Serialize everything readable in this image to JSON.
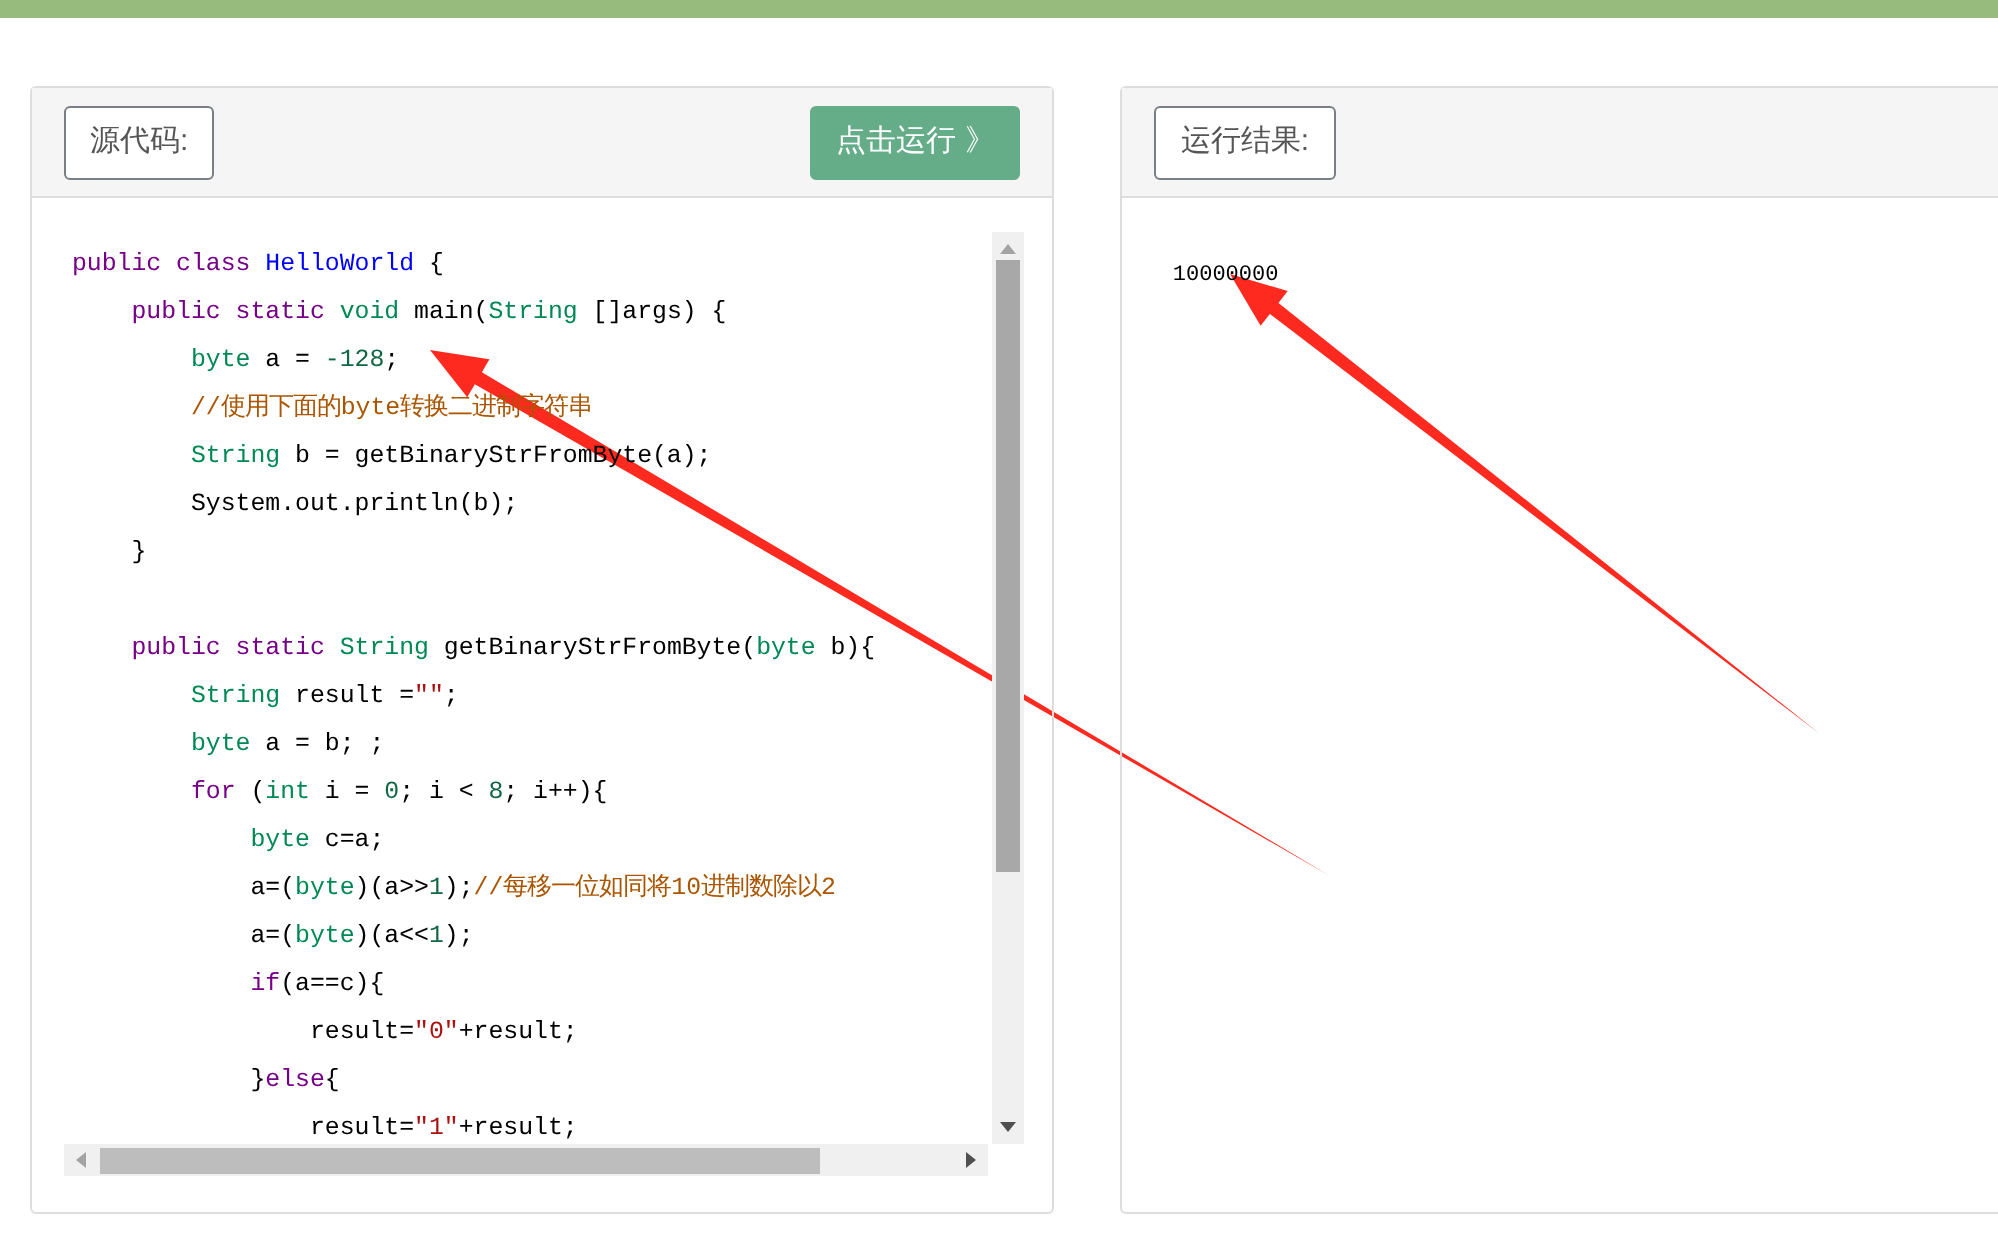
{
  "source_panel": {
    "label": "源代码:",
    "run_button": "点击运行 》",
    "code_lines": [
      {
        "kind": "code",
        "tokens": [
          {
            "kind": "keyword",
            "text": "public class "
          },
          {
            "kind": "classname",
            "text": "HelloWorld"
          },
          {
            "kind": "plain",
            "text": " {"
          }
        ]
      },
      {
        "kind": "code",
        "tokens": [
          {
            "kind": "keyword",
            "text": "    public static "
          },
          {
            "kind": "type",
            "text": "void"
          },
          {
            "kind": "plain",
            "text": " main("
          },
          {
            "kind": "type",
            "text": "String"
          },
          {
            "kind": "plain",
            "text": " []args) {"
          }
        ]
      },
      {
        "kind": "code",
        "tokens": [
          {
            "kind": "type",
            "text": "        byte"
          },
          {
            "kind": "plain",
            "text": " a = "
          },
          {
            "kind": "number",
            "text": "-128"
          },
          {
            "kind": "plain",
            "text": ";"
          }
        ]
      },
      {
        "kind": "code",
        "tokens": [
          {
            "kind": "comment",
            "text": "        //使用下面的byte转换二进制字符串"
          }
        ]
      },
      {
        "kind": "code",
        "tokens": [
          {
            "kind": "type",
            "text": "        String"
          },
          {
            "kind": "plain",
            "text": " b = getBinaryStrFromByte(a);"
          }
        ]
      },
      {
        "kind": "code",
        "tokens": [
          {
            "kind": "plain",
            "text": "        System.out.println(b);"
          }
        ]
      },
      {
        "kind": "code",
        "tokens": [
          {
            "kind": "plain",
            "text": "    }"
          }
        ]
      },
      {
        "kind": "blank"
      },
      {
        "kind": "code",
        "tokens": [
          {
            "kind": "keyword",
            "text": "    public static "
          },
          {
            "kind": "type",
            "text": "String"
          },
          {
            "kind": "plain",
            "text": " getBinaryStrFromByte("
          },
          {
            "kind": "type",
            "text": "byte"
          },
          {
            "kind": "plain",
            "text": " b){"
          }
        ]
      },
      {
        "kind": "code",
        "tokens": [
          {
            "kind": "type",
            "text": "        String"
          },
          {
            "kind": "plain",
            "text": " result ="
          },
          {
            "kind": "string",
            "text": "\"\""
          },
          {
            "kind": "plain",
            "text": ";"
          }
        ]
      },
      {
        "kind": "code",
        "tokens": [
          {
            "kind": "type",
            "text": "        byte"
          },
          {
            "kind": "plain",
            "text": " a = b; ;"
          }
        ]
      },
      {
        "kind": "code",
        "tokens": [
          {
            "kind": "keyword",
            "text": "        for"
          },
          {
            "kind": "plain",
            "text": " ("
          },
          {
            "kind": "type",
            "text": "int"
          },
          {
            "kind": "plain",
            "text": " i = "
          },
          {
            "kind": "number",
            "text": "0"
          },
          {
            "kind": "plain",
            "text": "; i < "
          },
          {
            "kind": "number",
            "text": "8"
          },
          {
            "kind": "plain",
            "text": "; i++){"
          }
        ]
      },
      {
        "kind": "code",
        "tokens": [
          {
            "kind": "type",
            "text": "            byte"
          },
          {
            "kind": "plain",
            "text": " c=a;"
          }
        ]
      },
      {
        "kind": "code",
        "tokens": [
          {
            "kind": "plain",
            "text": "            a=("
          },
          {
            "kind": "type",
            "text": "byte"
          },
          {
            "kind": "plain",
            "text": ")(a>>"
          },
          {
            "kind": "number",
            "text": "1"
          },
          {
            "kind": "plain",
            "text": ");"
          },
          {
            "kind": "comment",
            "text": "//每移一位如同将10进制数除以2"
          }
        ]
      },
      {
        "kind": "code",
        "tokens": [
          {
            "kind": "plain",
            "text": "            a=("
          },
          {
            "kind": "type",
            "text": "byte"
          },
          {
            "kind": "plain",
            "text": ")(a<<"
          },
          {
            "kind": "number",
            "text": "1"
          },
          {
            "kind": "plain",
            "text": ");"
          }
        ]
      },
      {
        "kind": "code",
        "tokens": [
          {
            "kind": "keyword",
            "text": "            if"
          },
          {
            "kind": "plain",
            "text": "(a==c){"
          }
        ]
      },
      {
        "kind": "code",
        "tokens": [
          {
            "kind": "plain",
            "text": "                result="
          },
          {
            "kind": "string",
            "text": "\"0\""
          },
          {
            "kind": "plain",
            "text": "+result;"
          }
        ]
      },
      {
        "kind": "code",
        "tokens": [
          {
            "kind": "plain",
            "text": "            }"
          },
          {
            "kind": "keyword",
            "text": "else"
          },
          {
            "kind": "plain",
            "text": "{"
          }
        ]
      },
      {
        "kind": "code",
        "tokens": [
          {
            "kind": "plain",
            "text": "                result="
          },
          {
            "kind": "string",
            "text": "\"1\""
          },
          {
            "kind": "plain",
            "text": "+result;"
          }
        ]
      }
    ]
  },
  "result_panel": {
    "label": "运行结果:",
    "output": "10000000"
  }
}
